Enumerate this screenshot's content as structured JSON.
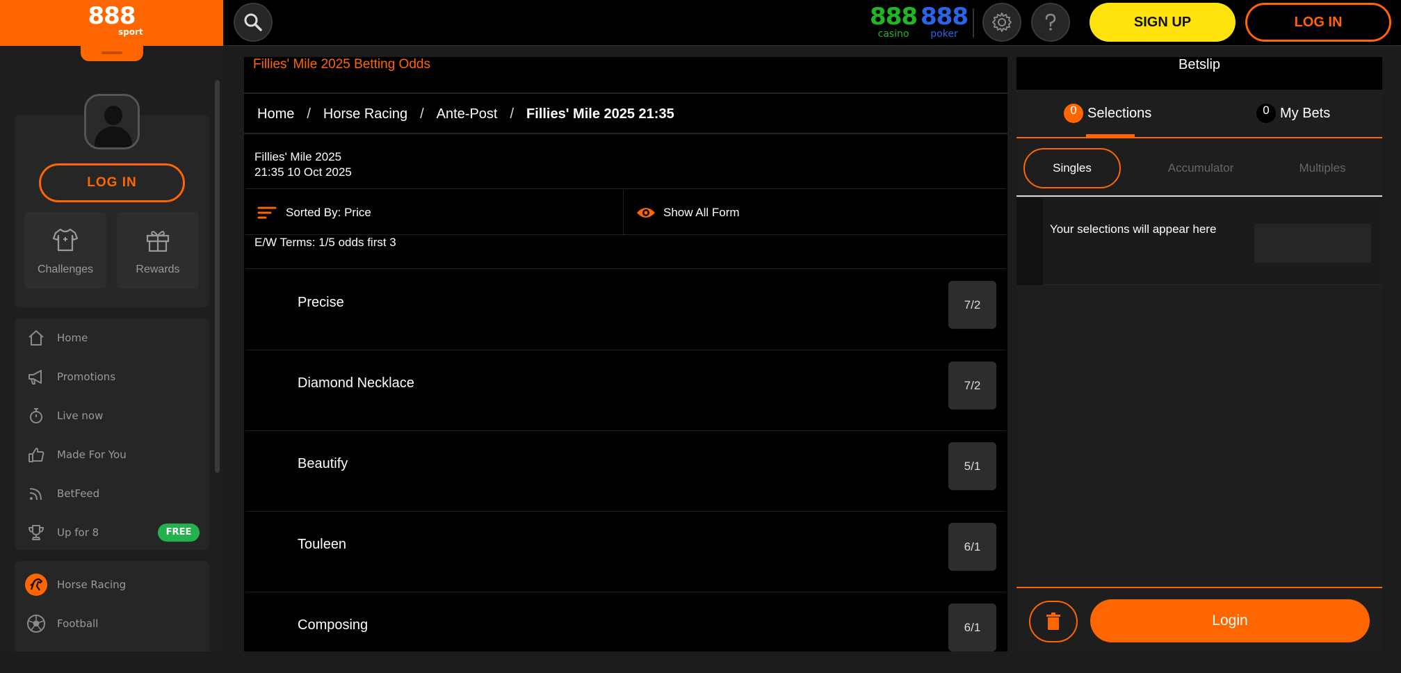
{
  "sidebar": {
    "logo": {
      "brand": "888",
      "sub": "sport"
    },
    "login_label": "LOG IN",
    "tiles": [
      {
        "label": "Challenges",
        "icon": "tshirt-icon"
      },
      {
        "label": "Rewards",
        "icon": "gift-icon"
      }
    ],
    "nav": [
      {
        "label": "Home",
        "icon": "home-icon"
      },
      {
        "label": "Promotions",
        "icon": "megaphone-icon"
      },
      {
        "label": "Live now",
        "icon": "stopwatch-icon"
      },
      {
        "label": "Made For You",
        "icon": "thumbs-up-icon"
      },
      {
        "label": "BetFeed",
        "icon": "feed-icon"
      },
      {
        "label": "Up for 8",
        "icon": "trophy-icon",
        "badge": "FREE"
      }
    ],
    "sports": [
      {
        "label": "Horse Racing",
        "icon": "horse-racing-icon"
      },
      {
        "label": "Football",
        "icon": "football-icon"
      }
    ]
  },
  "topbar": {
    "casino": {
      "num": "888",
      "sub": "casino",
      "color": "#1fb823"
    },
    "poker": {
      "num": "888",
      "sub": "poker",
      "color": "#2a64e8"
    },
    "signup_label": "SIGN UP",
    "login_label": "LOG IN"
  },
  "main": {
    "title": "Fillies' Mile 2025 Betting Odds",
    "breadcrumb": [
      "Home",
      "Horse Racing",
      "Ante-Post",
      "Fillies' Mile 2025 21:35"
    ],
    "event": {
      "name": "Fillies' Mile 2025",
      "time": "21:35 10 Oct 2025"
    },
    "sort_label": "Sorted By: Price",
    "form_label": "Show All Form",
    "ew_terms": "E/W Terms: 1/5 odds first 3",
    "runners": [
      {
        "name": "Precise",
        "odds": "7/2"
      },
      {
        "name": "Diamond Necklace",
        "odds": "7/2"
      },
      {
        "name": "Beautify",
        "odds": "5/1"
      },
      {
        "name": "Touleen",
        "odds": "6/1"
      },
      {
        "name": "Composing",
        "odds": "6/1"
      }
    ]
  },
  "betslip": {
    "title": "Betslip",
    "tabs": [
      {
        "count": "0",
        "label": "Selections"
      },
      {
        "count": "0",
        "label": "My Bets"
      }
    ],
    "bet_types": [
      "Singles",
      "Accumulator",
      "Multiples"
    ],
    "empty_message": "Your selections will appear here",
    "login_label": "Login"
  },
  "colors": {
    "accent": "#ff6600",
    "signup": "#ffe30a",
    "free": "#22b14c"
  }
}
